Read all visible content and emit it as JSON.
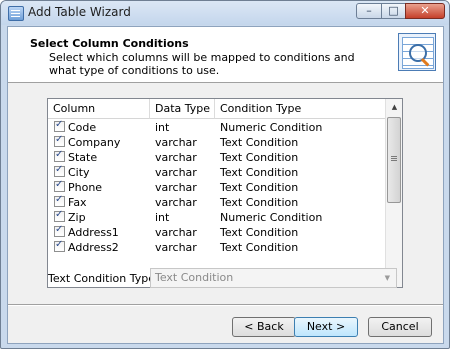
{
  "window": {
    "title": "Add Table Wizard"
  },
  "header": {
    "title": "Select Column Conditions",
    "description": "Select which columns will be mapped to conditions and what type of conditions to use."
  },
  "list": {
    "columns": [
      "Column",
      "Data Type",
      "Condition Type"
    ],
    "rows": [
      {
        "checked": true,
        "column": "Code",
        "type": "int",
        "condition": "Numeric Condition"
      },
      {
        "checked": true,
        "column": "Company",
        "type": "varchar",
        "condition": "Text Condition"
      },
      {
        "checked": true,
        "column": "State",
        "type": "varchar",
        "condition": "Text Condition"
      },
      {
        "checked": true,
        "column": "City",
        "type": "varchar",
        "condition": "Text Condition"
      },
      {
        "checked": true,
        "column": "Phone",
        "type": "varchar",
        "condition": "Text Condition"
      },
      {
        "checked": true,
        "column": "Fax",
        "type": "varchar",
        "condition": "Text Condition"
      },
      {
        "checked": true,
        "column": "Zip",
        "type": "int",
        "condition": "Numeric Condition"
      },
      {
        "checked": true,
        "column": "Address1",
        "type": "varchar",
        "condition": "Text Condition"
      },
      {
        "checked": true,
        "column": "Address2",
        "type": "varchar",
        "condition": "Text Condition"
      }
    ]
  },
  "text_condition": {
    "label": "Text Condition Type:",
    "value": "Text Condition"
  },
  "buttons": {
    "back": "< Back",
    "next": "Next >",
    "cancel": "Cancel"
  },
  "colors": {
    "accent": "#3c7fb1",
    "titlebar": "#c4d6ec",
    "close": "#c5402a"
  }
}
